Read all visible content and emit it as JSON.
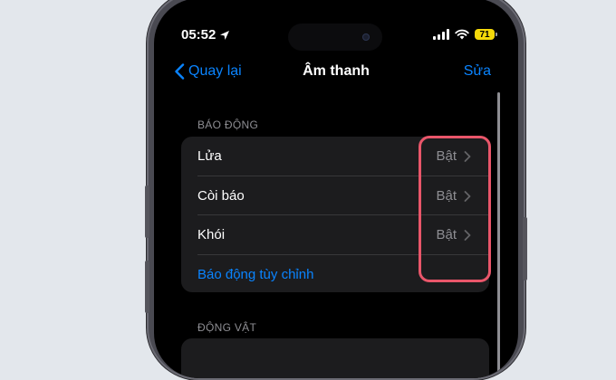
{
  "status": {
    "time": "05:52",
    "battery": "71",
    "location_icon": "location-arrow-icon",
    "signal_icon": "cellular-signal-icon",
    "wifi_icon": "wifi-icon",
    "battery_color": "#f5d90a"
  },
  "nav": {
    "back_label": "Quay lại",
    "title": "Âm thanh",
    "edit_label": "Sửa"
  },
  "sections": {
    "alarms_header": "BÁO ĐỘNG",
    "animals_header": "ĐỘNG VẬT"
  },
  "alarms": {
    "items": [
      {
        "label": "Lửa",
        "value": "Bật"
      },
      {
        "label": "Còi báo",
        "value": "Bật"
      },
      {
        "label": "Khói",
        "value": "Bật"
      }
    ],
    "custom_label": "Báo động tùy chỉnh"
  },
  "colors": {
    "accent": "#0a84ff",
    "highlight": "#e9566a"
  }
}
